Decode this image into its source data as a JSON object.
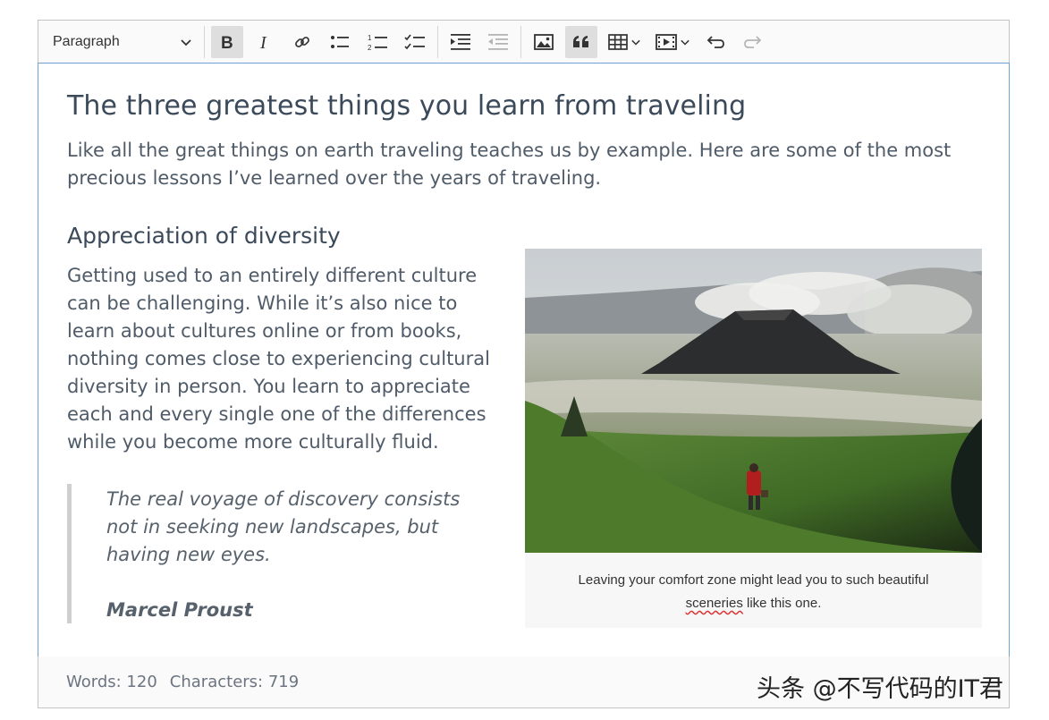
{
  "toolbar": {
    "heading": "Paragraph",
    "buttons": [
      "bold-icon",
      "italic-icon",
      "link-icon",
      "bulleted-list-icon",
      "numbered-list-icon",
      "todo-list-icon",
      "indent-icon",
      "outdent-icon",
      "image-icon",
      "blockquote-icon",
      "table-icon",
      "media-icon",
      "undo-icon",
      "redo-icon"
    ],
    "active": [
      "bold",
      "blockquote"
    ]
  },
  "content": {
    "title": "The three greatest things you learn from traveling",
    "intro": "Like all the great things on earth traveling teaches us by example. Here are some of the most precious lessons I’ve learned over the years of traveling.",
    "section_heading": "Appreciation of diversity",
    "section_paragraph": "Getting used to an entirely different culture can be challenging. While it’s also nice to learn about cultures online or from books, nothing comes close to experiencing cultural diversity in person. You learn to appreciate each and every single one of the differences while you become more culturally fluid.",
    "quote": "The real voyage of discovery consists not in seeking new landscapes, but having new eyes.",
    "quote_author": "Marcel Proust",
    "caption_start": "Leaving your comfort zone might lead you to such beautiful",
    "caption_misspelled": "sceneries",
    "caption_end": " like this one."
  },
  "footer": {
    "words": "Words: 120",
    "characters": "Characters: 719"
  },
  "watermark": "头条 @不写代码的IT君",
  "colors": {
    "accent_border": "#6ba3d6",
    "active_button": "#dedede",
    "text": "#4f5b68"
  }
}
